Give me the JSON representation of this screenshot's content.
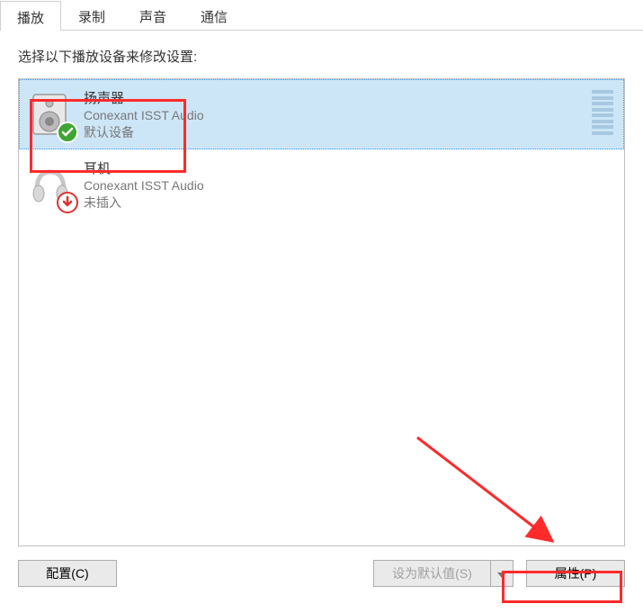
{
  "tabs": [
    {
      "label": "播放",
      "active": true
    },
    {
      "label": "录制",
      "active": false
    },
    {
      "label": "声音",
      "active": false
    },
    {
      "label": "通信",
      "active": false
    }
  ],
  "instruction": "选择以下播放设备来修改设置:",
  "devices": [
    {
      "name": "扬声器",
      "driver": "Conexant ISST Audio",
      "status": "默认设备",
      "selected": true,
      "icon": "speaker",
      "badge": "check"
    },
    {
      "name": "耳机",
      "driver": "Conexant ISST Audio",
      "status": "未插入",
      "selected": false,
      "icon": "headphone",
      "badge": "down"
    }
  ],
  "buttons": {
    "configure": "配置(C)",
    "setdefault": "设为默认值(S)",
    "properties": "属性(P)"
  }
}
